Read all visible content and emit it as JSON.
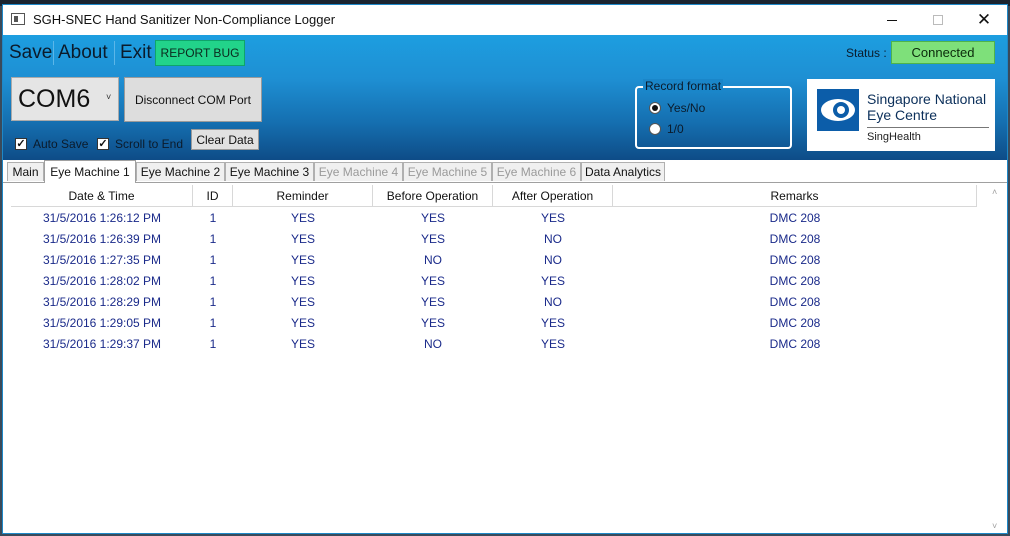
{
  "window": {
    "title": "SGH-SNEC Hand Sanitizer Non-Compliance Logger",
    "minimize_icon": "minimize-icon",
    "maximize_icon": "maximize-icon",
    "close_icon": "close-icon",
    "close_glyph": "✕"
  },
  "menu": {
    "save": "Save",
    "about": "About",
    "exit": "Exit",
    "report_bug": "REPORT BUG"
  },
  "status": {
    "label": "Status :",
    "value": "Connected",
    "color": "#7ee07a"
  },
  "com": {
    "selected": "COM6",
    "chevron": "˅",
    "disconnect_label": "Disconnect COM Port"
  },
  "options": {
    "auto_save": {
      "label": "Auto Save",
      "checked": true,
      "mark": "✓"
    },
    "scroll_to_end": {
      "label": "Scroll to End",
      "checked": true,
      "mark": "✓"
    },
    "clear_data": "Clear Data"
  },
  "record_format": {
    "legend": "Record format",
    "options": [
      {
        "label": "Yes/No",
        "selected": true
      },
      {
        "label": "1/0",
        "selected": false
      }
    ]
  },
  "logo": {
    "line1": "Singapore National",
    "line2": "Eye Centre",
    "line3": "SingHealth",
    "brand_color": "#0c5da9"
  },
  "tabs": [
    {
      "label": "Main",
      "state": "normal"
    },
    {
      "label": "Eye Machine 1",
      "state": "active"
    },
    {
      "label": "Eye Machine 2",
      "state": "normal"
    },
    {
      "label": "Eye Machine 3",
      "state": "normal"
    },
    {
      "label": "Eye Machine 4",
      "state": "disabled"
    },
    {
      "label": "Eye Machine 5",
      "state": "disabled"
    },
    {
      "label": "Eye Machine 6",
      "state": "disabled"
    },
    {
      "label": "Data Analytics",
      "state": "normal"
    }
  ],
  "table": {
    "columns": [
      "Date & Time",
      "ID",
      "Reminder",
      "Before Operation",
      "After Operation",
      "Remarks"
    ],
    "rows": [
      [
        "31/5/2016 1:26:12 PM",
        "1",
        "YES",
        "YES",
        "YES",
        "DMC 208"
      ],
      [
        "31/5/2016 1:26:39 PM",
        "1",
        "YES",
        "YES",
        "NO",
        "DMC 208"
      ],
      [
        "31/5/2016 1:27:35 PM",
        "1",
        "YES",
        "NO",
        "NO",
        "DMC 208"
      ],
      [
        "31/5/2016 1:28:02 PM",
        "1",
        "YES",
        "YES",
        "YES",
        "DMC 208"
      ],
      [
        "31/5/2016 1:28:29 PM",
        "1",
        "YES",
        "YES",
        "NO",
        "DMC 208"
      ],
      [
        "31/5/2016 1:29:05 PM",
        "1",
        "YES",
        "YES",
        "YES",
        "DMC 208"
      ],
      [
        "31/5/2016 1:29:37 PM",
        "1",
        "YES",
        "NO",
        "YES",
        "DMC 208"
      ]
    ]
  },
  "scrollbar": {
    "up_glyph": "˄",
    "down_glyph": "˅"
  }
}
